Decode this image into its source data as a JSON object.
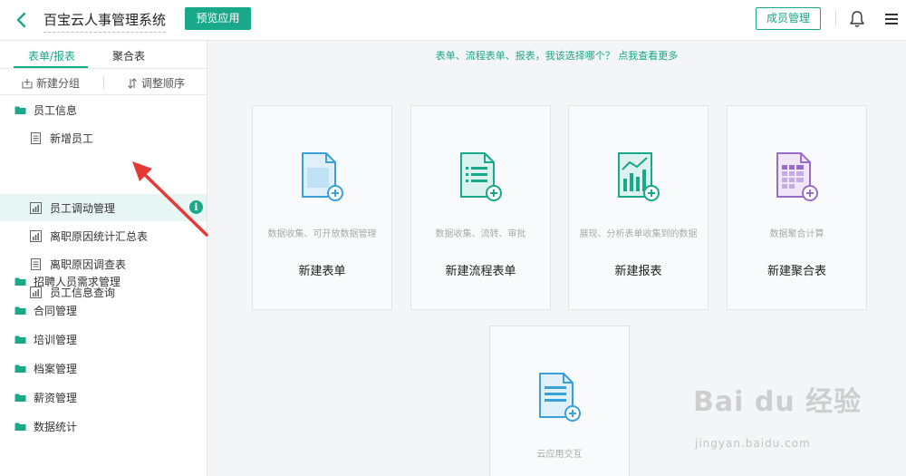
{
  "header": {
    "app_title": "百宝云人事管理系统",
    "preview_label": "预览应用",
    "member_label": "成员管理"
  },
  "sidebar": {
    "tabs": [
      {
        "label": "表单/报表",
        "active": true
      },
      {
        "label": "聚合表",
        "active": false
      }
    ],
    "tools": {
      "new_group": "新建分组",
      "reorder": "调整顺序"
    },
    "groups": [
      {
        "label": "员工信息",
        "icon": "folder-icon",
        "children": [
          {
            "label": "新增员工",
            "icon": "form-icon"
          },
          {
            "label": "员工调动管理",
            "icon": "report-icon",
            "active": true,
            "info": "i"
          },
          {
            "label": "离职原因统计汇总表",
            "icon": "report-icon"
          },
          {
            "label": "离职原因调查表",
            "icon": "form-icon"
          },
          {
            "label": "员工信息查询",
            "icon": "report-icon"
          }
        ]
      },
      {
        "label": "招聘人员需求管理",
        "icon": "folder-icon"
      },
      {
        "label": "合同管理",
        "icon": "folder-icon"
      },
      {
        "label": "培训管理",
        "icon": "folder-icon"
      },
      {
        "label": "档案管理",
        "icon": "folder-icon"
      },
      {
        "label": "薪资管理",
        "icon": "folder-icon"
      },
      {
        "label": "数据统计",
        "icon": "folder-icon"
      }
    ]
  },
  "main": {
    "hint": "表单、流程表单、报表，我该选择哪个？ 点我查看更多",
    "cards": [
      {
        "desc": "数据收集、可开放数据管理",
        "title": "新建表单",
        "icon": "new-form-icon"
      },
      {
        "desc": "数据收集、流转、审批",
        "title": "新建流程表单",
        "icon": "new-flow-form-icon"
      },
      {
        "desc": "展现、分析表单收集到的数据",
        "title": "新建报表",
        "icon": "new-report-icon"
      },
      {
        "desc": "数据聚合计算",
        "title": "新建聚合表",
        "icon": "new-aggregate-icon"
      },
      {
        "desc": "云应用交互",
        "title": "",
        "icon": "cloud-interaction-icon"
      }
    ]
  },
  "watermark": {
    "line1": "Bai du 经验",
    "line2": "jingyan.baidu.com"
  },
  "colors": {
    "accent": "#19a88a",
    "accent_light": "#e8f6f3",
    "icon_blue": "#3aa0d8",
    "icon_purple": "#9a6cc9",
    "arrow_red": "#e53935"
  }
}
